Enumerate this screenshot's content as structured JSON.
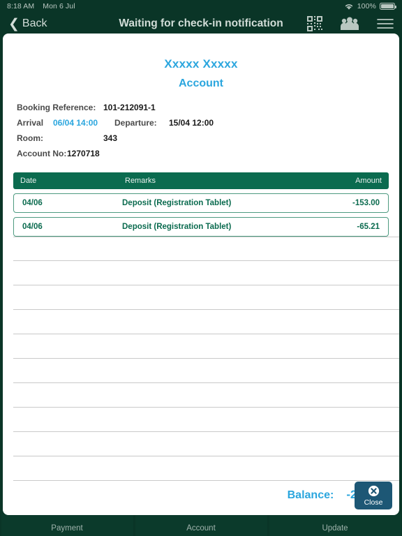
{
  "statusbar": {
    "time": "8:18 AM",
    "date": "Mon 6 Jul",
    "battery_percent": "100%",
    "wifi_icon": "wifi-icon",
    "battery_icon": "battery-full-icon"
  },
  "navbar": {
    "back_label": "Back",
    "title": "Waiting for check-in notification",
    "icons": [
      {
        "name": "qr-code-icon"
      },
      {
        "name": "group-people-icon"
      },
      {
        "name": "hamburger-menu-icon"
      }
    ]
  },
  "account_card": {
    "guest_name": "Xxxxx Xxxxx",
    "heading": "Account",
    "info": {
      "booking_reference_label": "Booking Reference:",
      "booking_reference_value": "101-212091-1",
      "arrival_label": "Arrival",
      "arrival_value": "06/04 14:00",
      "departure_label": "Departure:",
      "departure_value": "15/04 12:00",
      "room_label": "Room:",
      "room_value": "343",
      "account_no_label": "Account No:",
      "account_no_value": "1270718"
    },
    "table": {
      "columns": {
        "date": "Date",
        "remarks": "Remarks",
        "amount": "Amount"
      },
      "rows": [
        {
          "date": "04/06",
          "remarks": "Deposit (Registration Tablet)",
          "amount": "-153.00"
        },
        {
          "date": "04/06",
          "remarks": "Deposit (Registration Tablet)",
          "amount": "-65.21"
        }
      ],
      "empty_row_count": 10
    },
    "balance_label": "Balance:",
    "balance_value": "-218.21",
    "close_button_label": "Close",
    "close_button_icon": "close-circle-x-icon"
  },
  "tabbar": {
    "tabs": [
      {
        "label": "Payment"
      },
      {
        "label": "Account"
      },
      {
        "label": "Update"
      }
    ]
  },
  "colors": {
    "header_green": "#0a3527",
    "table_header_green": "#0b6b4f",
    "accent_blue": "#2ba6de",
    "row_border_green": "#4d9a80",
    "close_button_blue": "#1d5775"
  }
}
